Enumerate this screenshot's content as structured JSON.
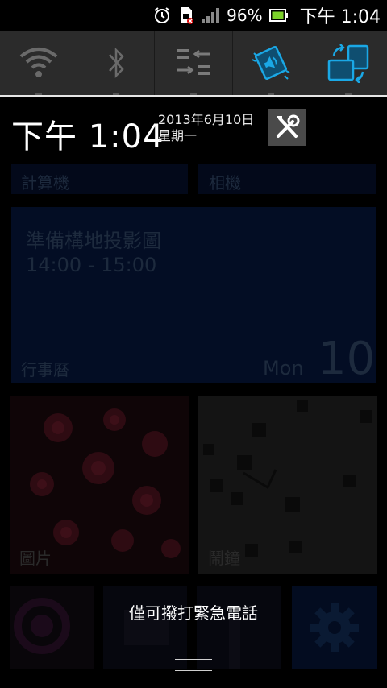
{
  "status_bar": {
    "icons": [
      "alarm-icon",
      "sim-card-missing-icon",
      "signal-icon",
      "battery-icon"
    ],
    "battery_percent": "96%",
    "time": "下午 1:04"
  },
  "quick_settings": {
    "items": [
      {
        "name": "wifi",
        "icon": "wifi-icon",
        "active": false
      },
      {
        "name": "bluetooth",
        "icon": "bluetooth-icon",
        "active": false
      },
      {
        "name": "data-sync",
        "icon": "data-transfer-icon",
        "active": false
      },
      {
        "name": "sound-vibrate",
        "icon": "sound-vibrate-icon",
        "active": true
      },
      {
        "name": "auto-rotate",
        "icon": "auto-rotate-icon",
        "active": true
      }
    ],
    "active_color": "#1aa8e6"
  },
  "header": {
    "time": "下午 1:04",
    "date": "2013年6月10日",
    "weekday": "星期一",
    "settings_icon": "tools-icon"
  },
  "home": {
    "tiles": {
      "calculator": "計算機",
      "camera": "相機",
      "calendar": {
        "event_title": "準備構地投影圖",
        "event_time": "14:00 - 15:00",
        "label": "行事曆",
        "day_name": "Mon",
        "day_number": "10"
      },
      "photos": "圖片",
      "clock": "鬧鐘"
    }
  },
  "lockscreen": {
    "emergency_text": "僅可撥打緊急電話"
  }
}
